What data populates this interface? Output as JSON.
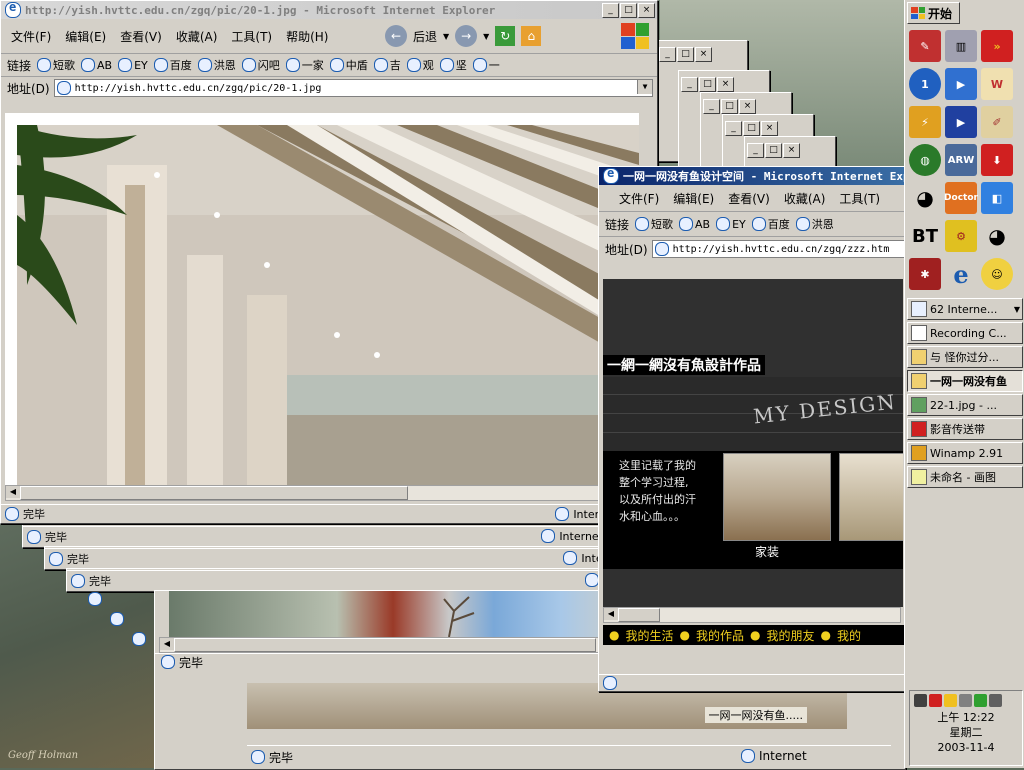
{
  "desktop": {
    "watermark": "Geoff Holman"
  },
  "ie": {
    "menu": [
      "文件(F)",
      "编辑(E)",
      "查看(V)",
      "收藏(A)",
      "工具(T)",
      "帮助(H)"
    ],
    "back_label": "后退",
    "links_label": "链接",
    "address_label": "地址(D)",
    "status_done": "完毕",
    "zone": "Internet"
  },
  "win1": {
    "title": "http://yish.hvttc.edu.cn/zgq/pic/20-1.jpg - Microsoft Internet Explorer",
    "links": [
      "短歌",
      "AB",
      "EY",
      "百度",
      "洪恩",
      "闪吧",
      "一家",
      "中盾",
      "吉",
      "观",
      "坚",
      "一"
    ],
    "url": "http://yish.hvttc.edu.cn/zgq/pic/20-1.jpg"
  },
  "win2": {
    "title": "一网一网没有鱼设计空间 - Microsoft Internet Explorer",
    "menu": [
      "文件(F)",
      "编辑(E)",
      "查看(V)",
      "收藏(A)",
      "工具(T)"
    ],
    "links": [
      "短歌",
      "AB",
      "EY",
      "百度",
      "洪恩"
    ],
    "url": "http://yish.hvttc.edu.cn/zgq/zzz.htm",
    "page": {
      "heading": "一網一網沒有魚設計作品",
      "banner": "MY DESIGN",
      "intro": [
        "这里记载了我的",
        "整个学习过程,",
        "以及所付出的汗",
        "水和心血。。。"
      ],
      "thumb_label": "家装",
      "nav": [
        "我的生活",
        "我的作品",
        "我的朋友",
        "我的"
      ]
    }
  },
  "bottom_window": {
    "caption": "一网一网没有鱼....."
  },
  "taskbar": {
    "start": "开始",
    "quicklaunch": [
      "form-icon",
      "server-icon",
      "winamp-arrow-icon",
      "one-icon",
      "play-icon",
      "office-icon",
      "flashget-icon",
      "media-icon",
      "brush-icon",
      "network-icon",
      "arw-icon",
      "download-icon",
      "qq-icon",
      "doctor-icon",
      "cube-icon",
      "bt-icon",
      "gear-icon",
      "qq2-icon",
      "spider-icon",
      "ie-icon",
      "smile-icon"
    ],
    "bt_label": "BT",
    "arw_label": "ARW",
    "doctor_label": "Doctor",
    "tasks": [
      {
        "label": "62 Interne...",
        "active": false
      },
      {
        "label": "Recording C...",
        "active": false
      },
      {
        "label": "与 怪你过分...",
        "active": false
      },
      {
        "label": "一网一网没有鱼",
        "active": true
      },
      {
        "label": "22-1.jpg - ...",
        "active": false
      },
      {
        "label": "影音传送带",
        "active": false
      },
      {
        "label": "Winamp 2.91",
        "active": false
      },
      {
        "label": "未命名 - 画图",
        "active": false
      }
    ],
    "clock": {
      "time": "上午 12:22",
      "weekday": "星期二",
      "date": "2003-11-4"
    }
  },
  "colors": {
    "title_active": "#0a246a",
    "title_inactive": "#c8c8c8",
    "face": "#d4d0c8"
  }
}
